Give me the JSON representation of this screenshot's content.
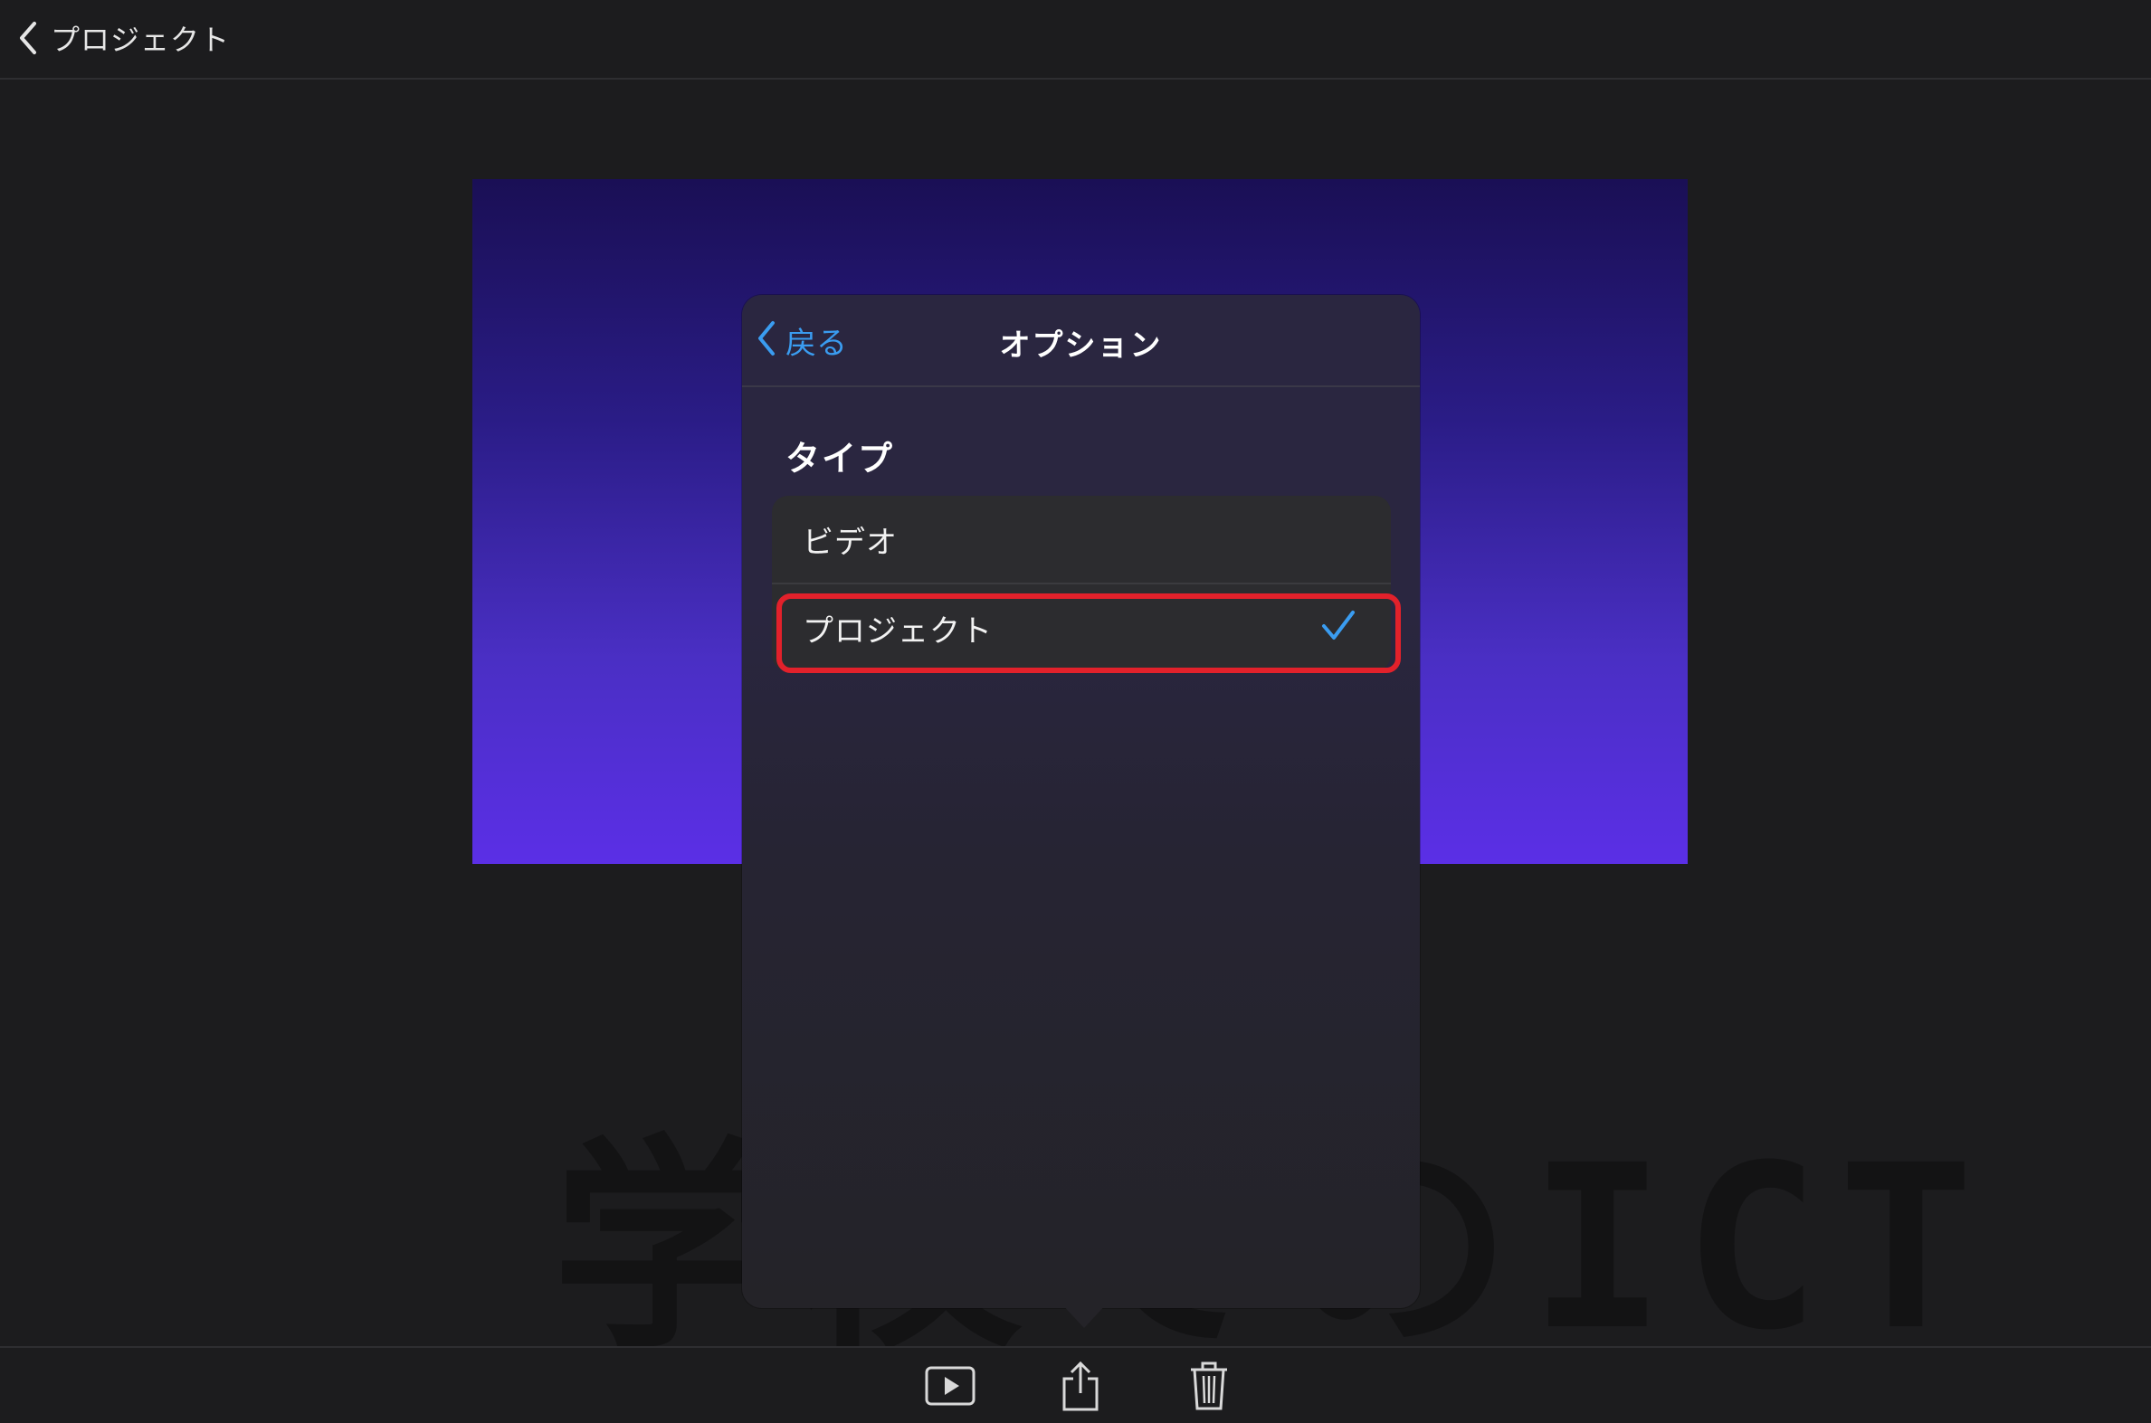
{
  "topbar": {
    "back_label": "プロジェクト"
  },
  "popover": {
    "back_label": "戻る",
    "title": "オプション",
    "section_title": "タイプ",
    "options": [
      {
        "label": "ビデオ",
        "selected": false
      },
      {
        "label": "プロジェクト",
        "selected": true
      }
    ]
  },
  "watermark": "学校でのICT",
  "colors": {
    "accent": "#3a9cf0",
    "highlight": "#e2212b",
    "background": "#1c1c1e"
  },
  "toolbar": {
    "icons": [
      "play-icon",
      "share-icon",
      "trash-icon"
    ]
  }
}
